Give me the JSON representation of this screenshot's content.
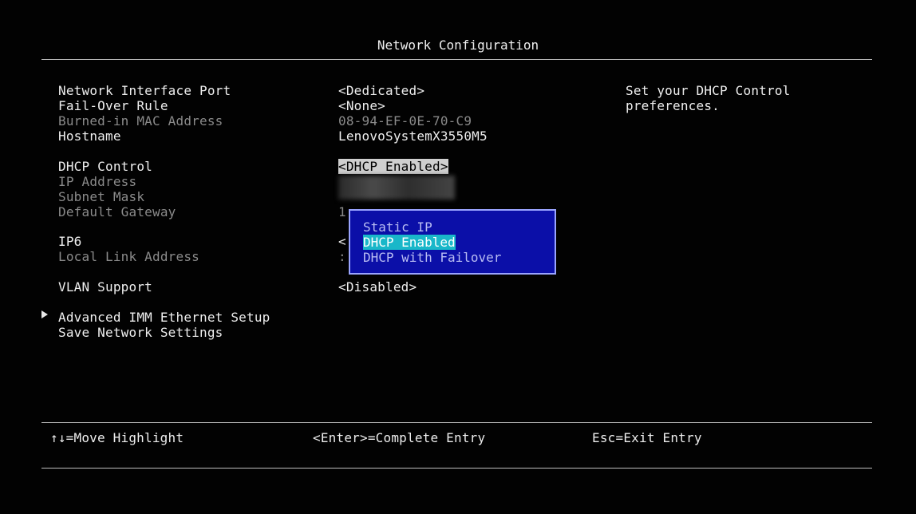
{
  "title": "Network Configuration",
  "fields": {
    "network_interface_port": {
      "label": "Network Interface Port",
      "value": "<Dedicated>"
    },
    "fail_over_rule": {
      "label": "Fail-Over Rule",
      "value": "<None>"
    },
    "burned_in_mac": {
      "label": "Burned-in MAC Address",
      "value": "08-94-EF-0E-70-C9"
    },
    "hostname": {
      "label": "Hostname",
      "value": "LenovoSystemX3550M5"
    },
    "dhcp_control": {
      "label": "DHCP Control",
      "value": "<DHCP Enabled>"
    },
    "ip_address": {
      "label": "IP Address"
    },
    "subnet_mask": {
      "label": "Subnet Mask"
    },
    "default_gateway": {
      "label": "Default Gateway",
      "value_partial": "1"
    },
    "ip6": {
      "label": "IP6",
      "value_partial": "<"
    },
    "local_link_address": {
      "label": "Local Link Address",
      "value_partial": ":"
    },
    "vlan_support": {
      "label": "VLAN Support",
      "value": "<Disabled>"
    }
  },
  "actions": {
    "advanced_imm": "Advanced IMM Ethernet Setup",
    "save_network": "Save Network Settings"
  },
  "help_text": {
    "line1": "Set your DHCP Control",
    "line2": "preferences."
  },
  "popup": {
    "options": [
      "Static IP",
      "DHCP Enabled",
      "DHCP with Failover"
    ],
    "selected": "DHCP Enabled"
  },
  "footer": {
    "move": "↑↓=Move Highlight",
    "enter": "<Enter>=Complete Entry",
    "esc": "Esc=Exit Entry"
  },
  "colors": {
    "background": "#020202",
    "popup_bg": "#0b0fa8",
    "popup_border": "#9aa4ff",
    "highlight": "#19b7c9",
    "selected_value_bg": "#cfcfcf"
  }
}
